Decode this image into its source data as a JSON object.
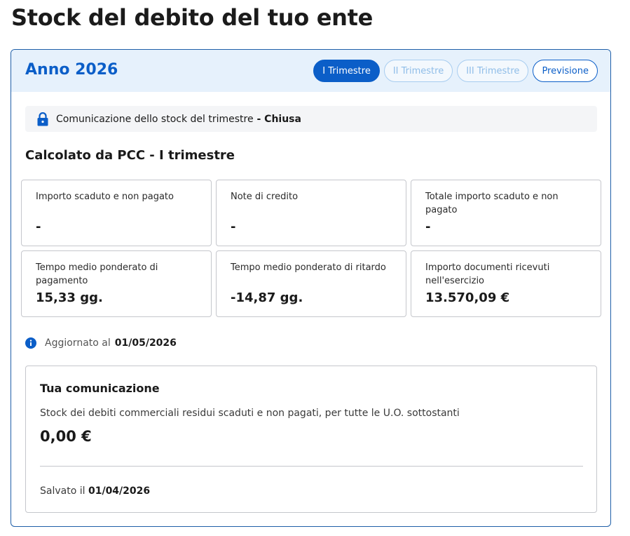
{
  "page": {
    "title": "Stock del debito del tuo ente"
  },
  "header": {
    "year_title": "Anno 2026",
    "tabs": [
      {
        "label": "I Trimestre",
        "state": "active"
      },
      {
        "label": "II Trimestre",
        "state": "disabled"
      },
      {
        "label": "III Trimestre",
        "state": "disabled"
      },
      {
        "label": "Previsione",
        "state": "enabled"
      }
    ]
  },
  "lock_bar": {
    "icon": "lock-icon",
    "text": "Comunicazione dello stock del trimestre",
    "separator": " - ",
    "status": "Chiusa"
  },
  "pcc": {
    "title": "Calcolato da PCC - I trimestre",
    "tiles": [
      {
        "label": "Importo scaduto e non pagato",
        "value": "-"
      },
      {
        "label": "Note di credito",
        "value": "-"
      },
      {
        "label": "Totale importo scaduto e non pagato",
        "value": "-"
      },
      {
        "label": "Tempo medio ponderato di pagamento",
        "value": "15,33 gg."
      },
      {
        "label": "Tempo medio ponderato di ritardo",
        "value": "-14,87 gg."
      },
      {
        "label": "Importo documenti ricevuti nell'esercizio",
        "value": "13.570,09 €"
      }
    ]
  },
  "updated": {
    "icon": "info-icon",
    "label": "Aggiornato al",
    "date": "01/05/2026"
  },
  "communication": {
    "title": "Tua comunicazione",
    "description": "Stock dei debiti commerciali residui scaduti e non pagati, per tutte le U.O. sottostanti",
    "amount": "0,00 €",
    "saved_label": "Salvato il",
    "saved_date": "01/04/2026"
  },
  "colors": {
    "primary": "#0b5ec8",
    "header_bg": "#e6f1fc",
    "border": "#c5c7cc"
  }
}
